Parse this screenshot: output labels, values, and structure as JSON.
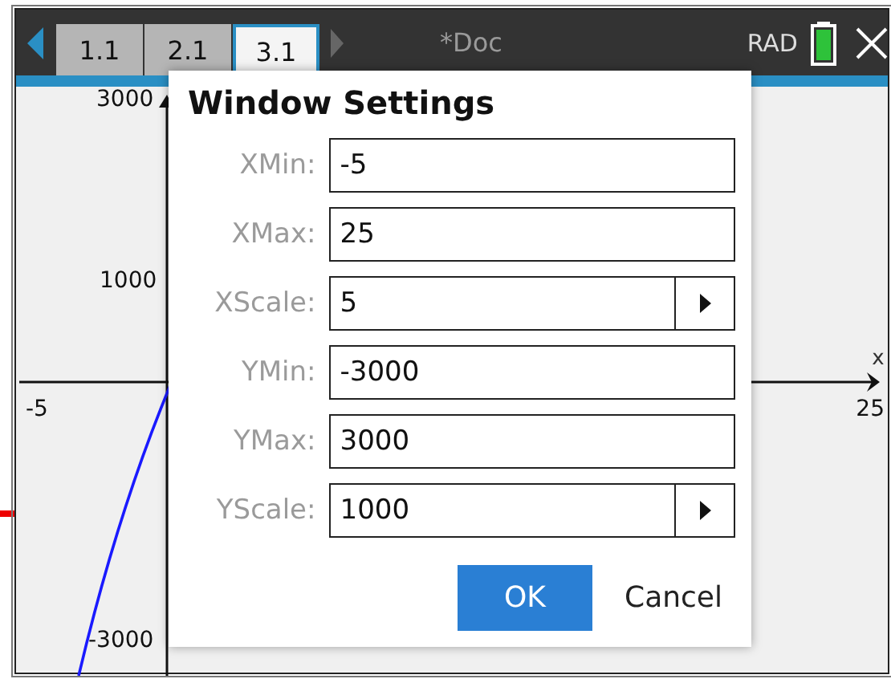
{
  "top_bar": {
    "tabs": [
      {
        "label": "1.1",
        "selected": false
      },
      {
        "label": "2.1",
        "selected": false
      },
      {
        "label": "3.1",
        "selected": true
      }
    ],
    "document_title": "*Doc",
    "angle_mode": "RAD"
  },
  "graph": {
    "x_axis_label": "x",
    "x_min_label": "-5",
    "x_max_label": "25",
    "y_labels": [
      {
        "label": "3000"
      },
      {
        "label": "1000"
      },
      {
        "label": "-3000"
      }
    ]
  },
  "dialog": {
    "title": "Window Settings",
    "fields": [
      {
        "label": "XMin:",
        "value": "-5",
        "kind": "text"
      },
      {
        "label": "XMax:",
        "value": "25",
        "kind": "text"
      },
      {
        "label": "XScale:",
        "value": "5",
        "kind": "dropdown"
      },
      {
        "label": "YMin:",
        "value": "-3000",
        "kind": "text"
      },
      {
        "label": "YMax:",
        "value": "3000",
        "kind": "text"
      },
      {
        "label": "YScale:",
        "value": "1000",
        "kind": "dropdown"
      }
    ],
    "buttons": [
      {
        "label": "OK",
        "selected": true
      },
      {
        "label": "Cancel",
        "selected": false
      }
    ]
  }
}
